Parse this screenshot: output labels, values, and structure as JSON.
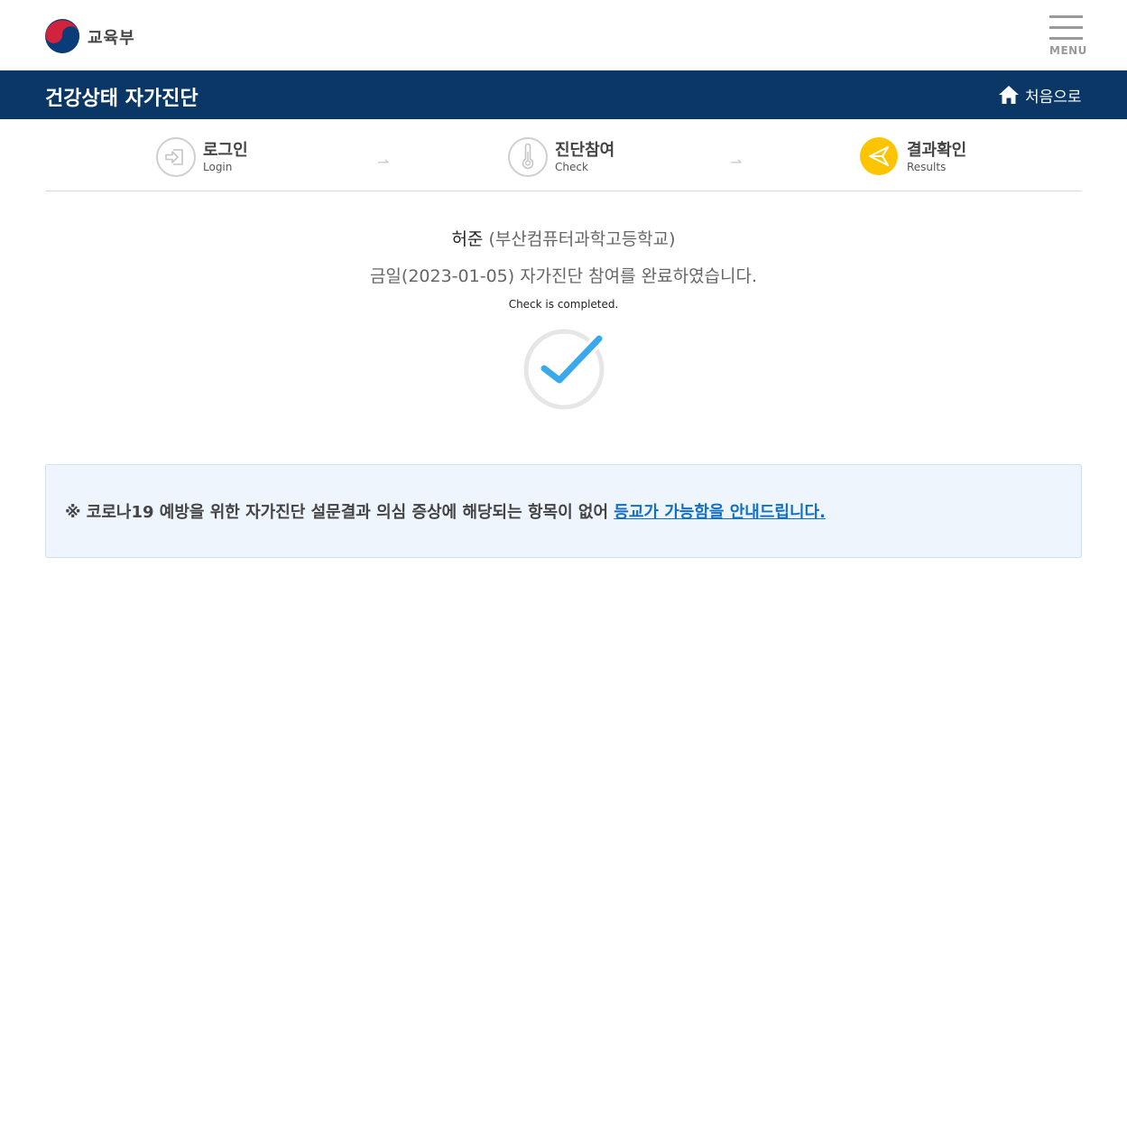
{
  "header": {
    "ministry_name": "교육부",
    "menu_label": "MENU"
  },
  "titlebar": {
    "title": "건강상태 자가진단",
    "home_label": "처음으로"
  },
  "steps": [
    {
      "label_kr": "로그인",
      "label_en": "Login",
      "icon": "login-icon",
      "active": false
    },
    {
      "label_kr": "진단참여",
      "label_en": "Check",
      "icon": "thermometer-icon",
      "active": false
    },
    {
      "label_kr": "결과확인",
      "label_en": "Results",
      "icon": "paper-plane-icon",
      "active": true
    }
  ],
  "result": {
    "student_name": "허준",
    "school": "(부산컴퓨터과학고등학교)",
    "completion_message": "금일(2023-01-05) 자가진단 참여를 완료하였습니다.",
    "completion_message_en": "Check is completed.",
    "status_icon": "check-circle-icon"
  },
  "notice": {
    "text": "※ 코로나19 예방을 위한 자가진단 설문결과 의심 증상에 해당되는 항목이 없어 ",
    "link_text": "등교가 가능함을 안내드립니다."
  },
  "colors": {
    "titlebar_bg": "#0a3766",
    "active_step": "#ffc400",
    "check_blue": "#3aa8ec",
    "link": "#1270c4",
    "notice_bg": "#eef5fc"
  }
}
